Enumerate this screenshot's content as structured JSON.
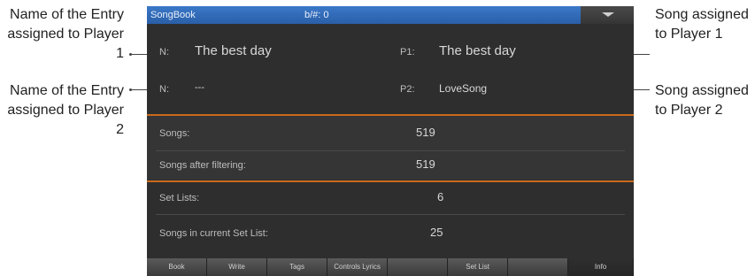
{
  "callouts": {
    "left_top": "Name of the Entry assigned to Player 1",
    "left_bottom": "Name of the Entry assigned to Player 2",
    "right_top": "Song assigned to Player 1",
    "right_bottom": "Song assigned to Player 2"
  },
  "titlebar": {
    "title": "SongBook",
    "key_info": "b/#: 0",
    "menu_icon": "menu-triangle-icon"
  },
  "players": {
    "row1": {
      "name_label": "N:",
      "name_value": "The best day",
      "player_label": "P1:",
      "player_value": "The best day"
    },
    "row2": {
      "name_label": "N:",
      "name_value": "---",
      "player_label": "P2:",
      "player_value": "LoveSong"
    }
  },
  "info": {
    "songs_label": "Songs:",
    "songs_value": "519",
    "filtered_label": "Songs after filtering:",
    "filtered_value": "519",
    "setlists_label": "Set Lists:",
    "setlists_value": "6",
    "current_label": "Songs in current Set List:",
    "current_value": "25"
  },
  "tabs": [
    "Book",
    "Write",
    "Tags",
    "Controls Lyrics",
    "",
    "Set List",
    "",
    "Info"
  ],
  "colors": {
    "title_bg": "#2a5fa8",
    "orange_separator": "#c8691d",
    "screen_bg": "#2e2e2e"
  }
}
